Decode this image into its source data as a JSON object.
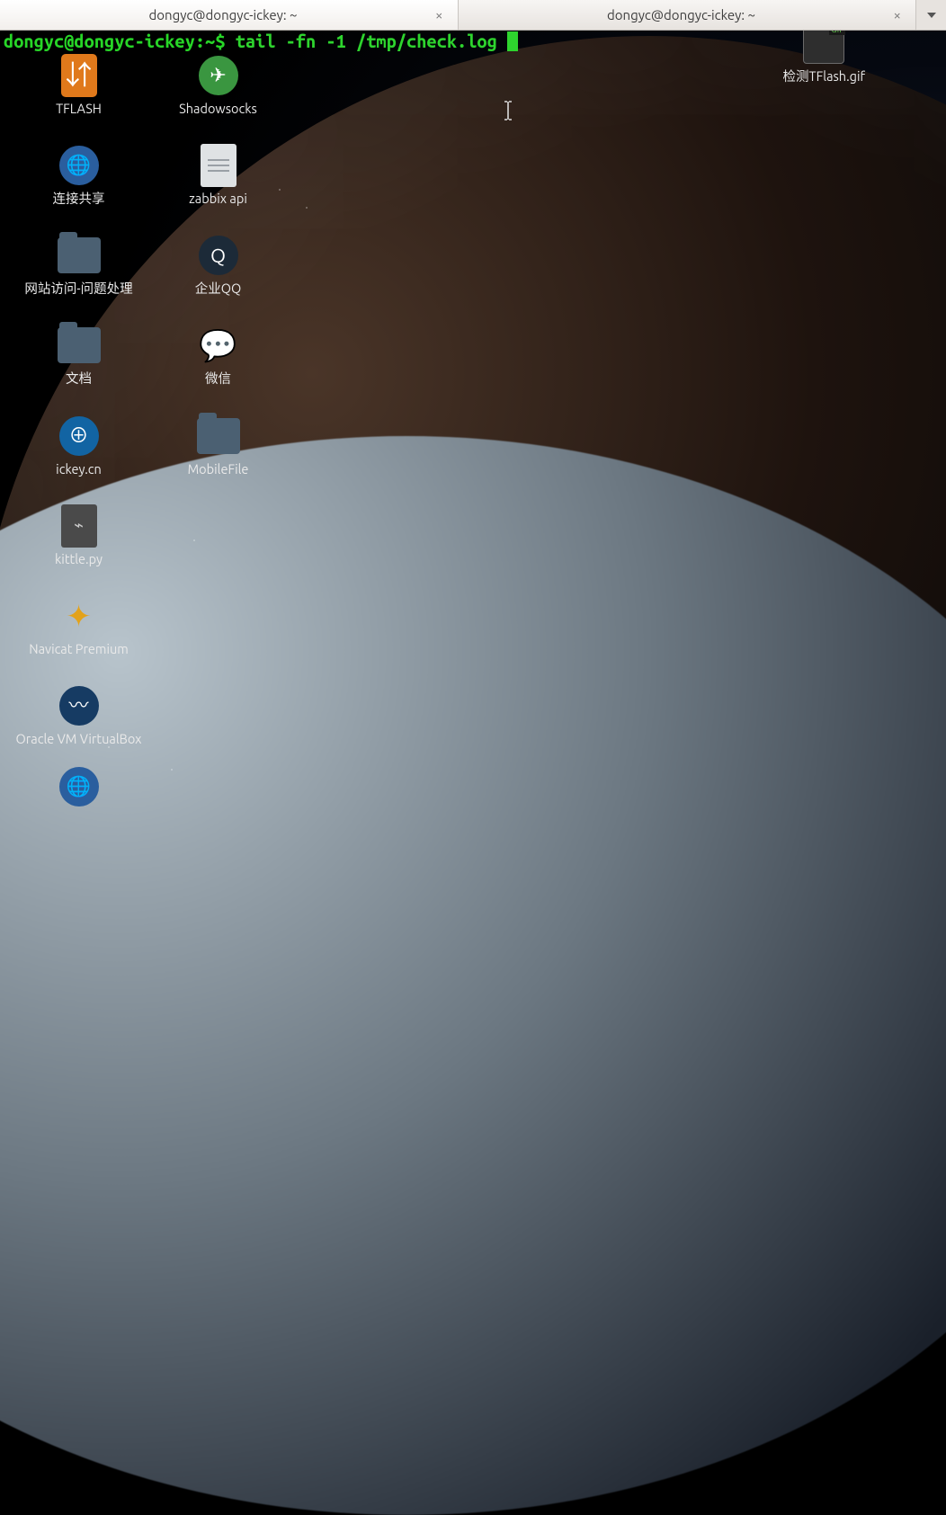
{
  "tabs": [
    {
      "title": "dongyc@dongyc-ickey: ~",
      "close": "×"
    },
    {
      "title": "dongyc@dongyc-ickey: ~",
      "close": "×"
    }
  ],
  "prompt": {
    "userhost": "dongyc@dongyc-ickey",
    "sep": ":",
    "path": "~",
    "symbol": "$",
    "command": "tail -fn -1 /tmp/check.log"
  },
  "desktop": {
    "col1": [
      {
        "label": "TFLASH",
        "kind": "usb"
      },
      {
        "label": "连接共享",
        "kind": "globe"
      },
      {
        "label": "网站访问-问题处理",
        "kind": "folder"
      },
      {
        "label": "文档",
        "kind": "folder"
      },
      {
        "label": "ickey.cn",
        "kind": "link"
      },
      {
        "label": "kittle.py",
        "kind": "py"
      },
      {
        "label": "Navicat Premium",
        "kind": "navicat"
      },
      {
        "label": "Oracle VM VirtualBox",
        "kind": "vbox"
      }
    ],
    "col2": [
      {
        "label": "Shadowsocks",
        "kind": "ss"
      },
      {
        "label": "zabbix api",
        "kind": "file"
      },
      {
        "label": "企业QQ",
        "kind": "qq"
      },
      {
        "label": "微信",
        "kind": "wechat"
      },
      {
        "label": "MobileFile",
        "kind": "folder"
      }
    ],
    "float_right": {
      "label": "检测TFlash.gif",
      "kind": "gif"
    },
    "partial_bottom_icon": "globe"
  },
  "colors": {
    "prompt_green": "#27d627",
    "folder": "#4b6072",
    "usb": "#e0791b"
  }
}
